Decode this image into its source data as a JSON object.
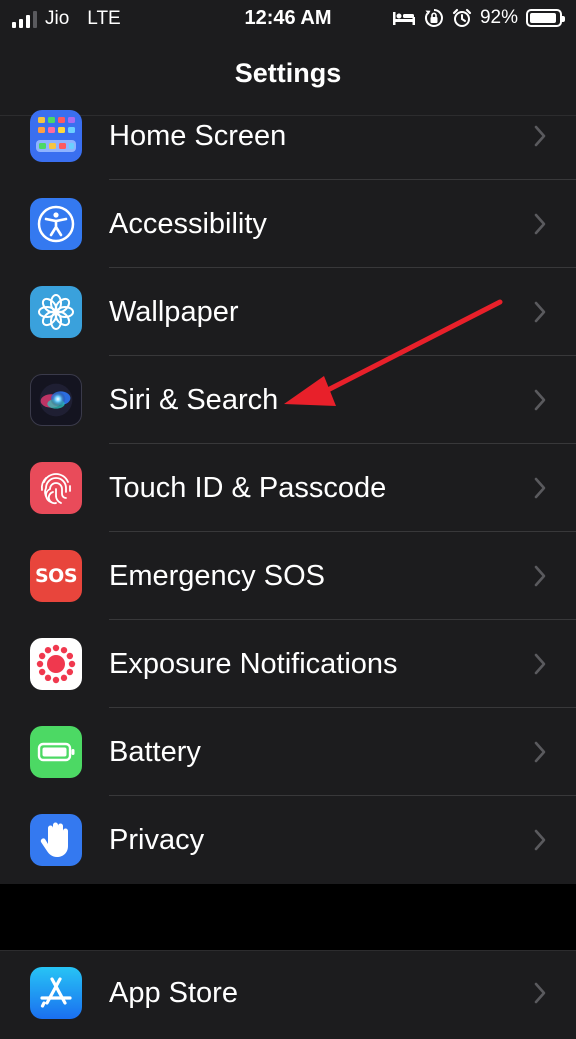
{
  "status_bar": {
    "carrier": "Jio",
    "network": "LTE",
    "time": "12:46 AM",
    "battery_percent": "92%",
    "battery_level": 0.92,
    "icons": [
      "signal-icon",
      "bed-icon",
      "orientation-lock-icon",
      "alarm-icon",
      "battery-icon"
    ]
  },
  "nav": {
    "title": "Settings"
  },
  "settings_group_1": [
    {
      "label": "Home Screen",
      "icon": "home-screen-icon",
      "color": "#3a6ff0"
    },
    {
      "label": "Accessibility",
      "icon": "accessibility-icon",
      "color": "#3479f0"
    },
    {
      "label": "Wallpaper",
      "icon": "wallpaper-icon",
      "color": "#3aa1dc"
    },
    {
      "label": "Siri & Search",
      "icon": "siri-icon",
      "color": "#1a1a2e"
    },
    {
      "label": "Touch ID & Passcode",
      "icon": "fingerprint-icon",
      "color": "#e94b5a"
    },
    {
      "label": "Emergency SOS",
      "icon": "sos-icon",
      "color": "#e8453c"
    },
    {
      "label": "Exposure Notifications",
      "icon": "exposure-icon",
      "color": "#ffffff"
    },
    {
      "label": "Battery",
      "icon": "battery-setting-icon",
      "color": "#4cd964"
    },
    {
      "label": "Privacy",
      "icon": "hand-icon",
      "color": "#3479f0"
    }
  ],
  "settings_group_2": [
    {
      "label": "App Store",
      "icon": "app-store-icon",
      "color": "#2d8cf0"
    }
  ],
  "annotation": {
    "arrow_color": "#e8202a",
    "points_to": "Siri & Search"
  }
}
